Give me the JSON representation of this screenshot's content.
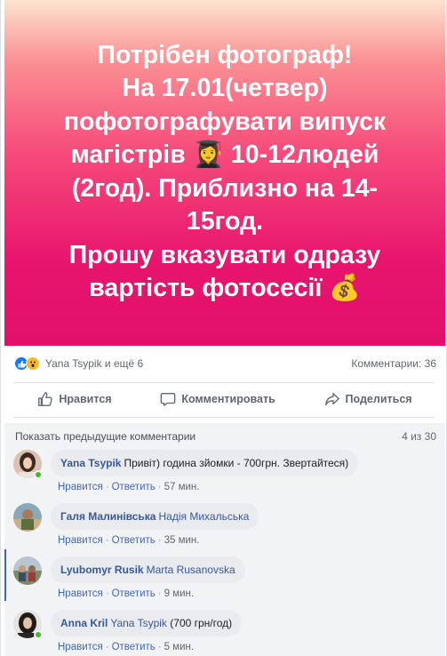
{
  "post": {
    "text": "Потрібен фотограф!\nНа 17.01(четвер)\nпофотографувати випуск\nмагістрів 👩‍🎓 10-12людей\n(2год). Приблизно на 14-\n15год.\nПрошу вказувати одразу\nвартість фотосесії 💰",
    "banner_colors": [
      "#fde3cf",
      "#f6497a",
      "#e0106b"
    ]
  },
  "stats": {
    "reactions_text": "Yana Tsypik и ещё 6",
    "comments_count": "Комментарии: 36",
    "reaction_icons": [
      "like-icon",
      "wow-icon"
    ]
  },
  "actions": {
    "like": "Нравится",
    "comment": "Комментировать",
    "share": "Поделиться"
  },
  "comments_section": {
    "show_previous": "Показать предыдущие комментарии",
    "pager": "4 из 30",
    "like_label": "Нравится",
    "reply_label": "Ответить",
    "items": [
      {
        "author": "Yana Tsypik",
        "mention": "",
        "text": "Привіт) година зйомки - 700грн. Звертайтеся)",
        "time": "57 мин.",
        "online": true
      },
      {
        "author": "Галя Малинівська",
        "mention": "Надія Михальська",
        "text": "",
        "time": "35 мин.",
        "online": false
      },
      {
        "author": "Lyubomyr Rusik",
        "mention": "Marta Rusanovska",
        "text": "",
        "time": "9 мин.",
        "online": false
      },
      {
        "author": "Anna Kril",
        "mention": "Yana Tsypik",
        "text": "(700 грн/год)",
        "time": "5 мин.",
        "online": true
      }
    ]
  }
}
